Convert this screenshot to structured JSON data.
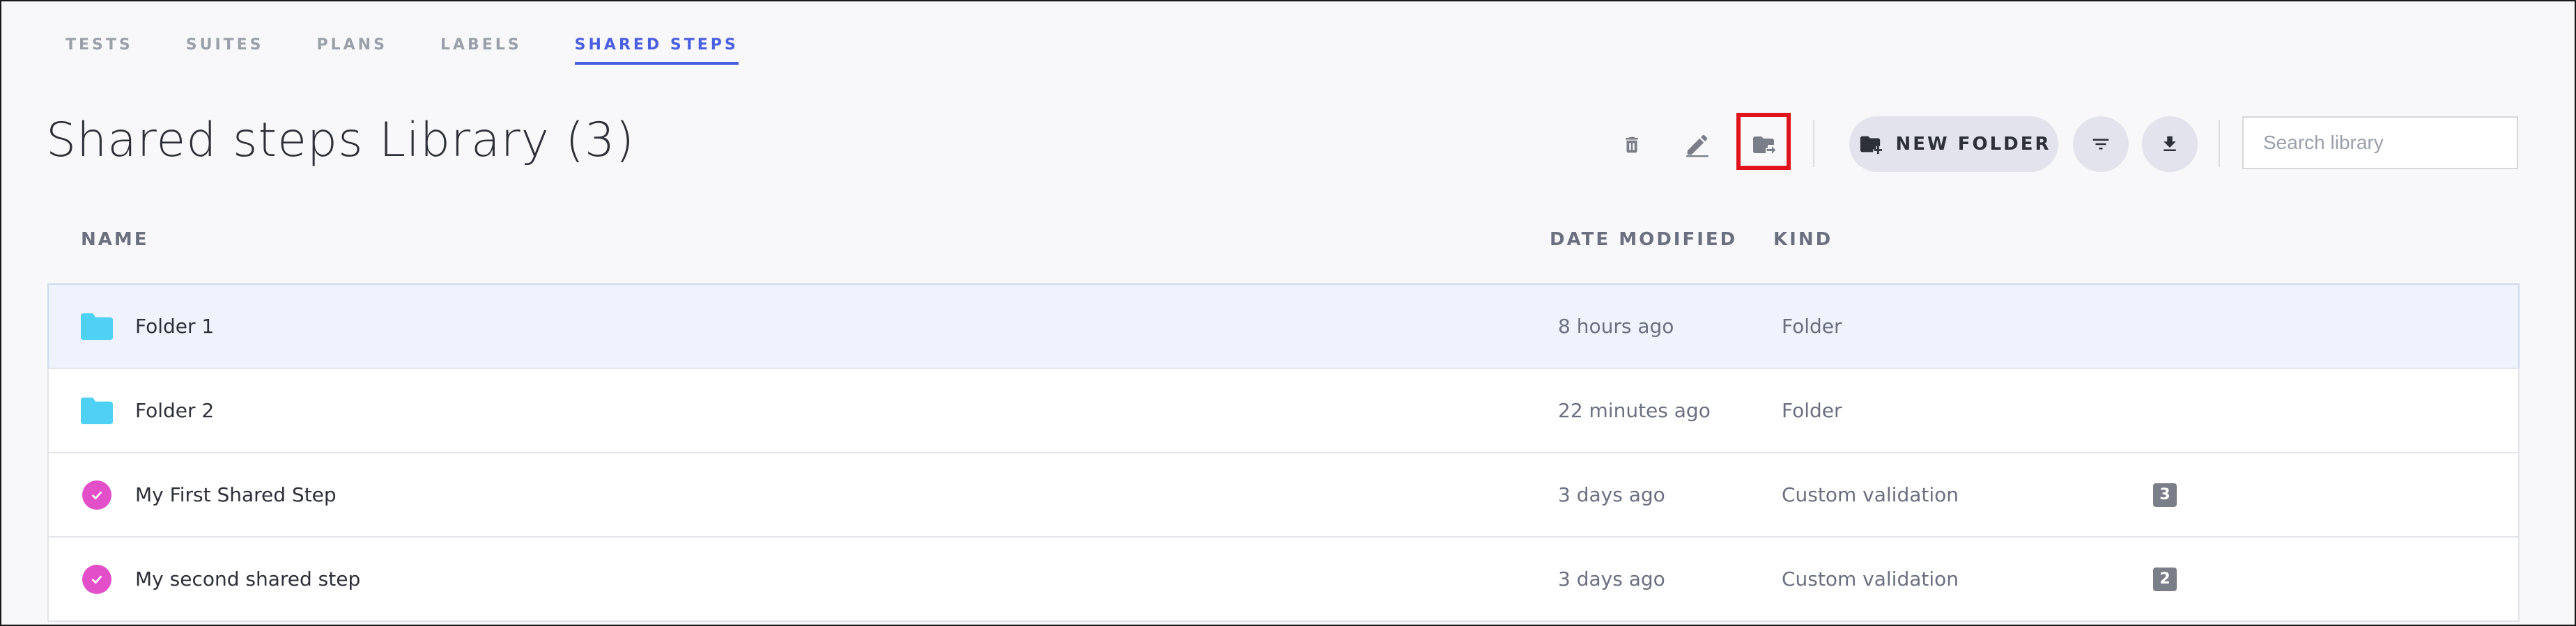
{
  "tabs": [
    {
      "label": "TESTS"
    },
    {
      "label": "SUITES"
    },
    {
      "label": "PLANS"
    },
    {
      "label": "LABELS"
    },
    {
      "label": "SHARED STEPS"
    }
  ],
  "active_tab": "SHARED STEPS",
  "page_title": "Shared steps Library (3)",
  "toolbar": {
    "new_folder_label": "NEW FOLDER",
    "search_placeholder": "Search library",
    "icons": [
      "trash-icon",
      "edit-pencil-icon",
      "move-folder-icon",
      "filter-icon",
      "download-icon"
    ]
  },
  "table": {
    "headers": {
      "name": "NAME",
      "date": "DATE MODIFIED",
      "kind": "KIND"
    },
    "rows": [
      {
        "name": "Folder 1",
        "date": "8 hours ago",
        "kind": "Folder",
        "count": "",
        "icon": "folder-icon",
        "selected": true
      },
      {
        "name": "Folder 2",
        "date": "22 minutes ago",
        "kind": "Folder",
        "count": "",
        "icon": "folder-icon",
        "selected": false
      },
      {
        "name": "My First Shared Step",
        "date": "3 days ago",
        "kind": "Custom validation",
        "count": "3",
        "icon": "check-circle-icon",
        "selected": false
      },
      {
        "name": "My second shared step",
        "date": "3 days ago",
        "kind": "Custom validation",
        "count": "2",
        "icon": "check-circle-icon",
        "selected": false
      }
    ]
  },
  "colors": {
    "accent": "#4a5ee0",
    "folder": "#4fd1f5",
    "check": "#e34fc8",
    "highlight": "#e0121b",
    "selected_row": "#eef3fd"
  }
}
